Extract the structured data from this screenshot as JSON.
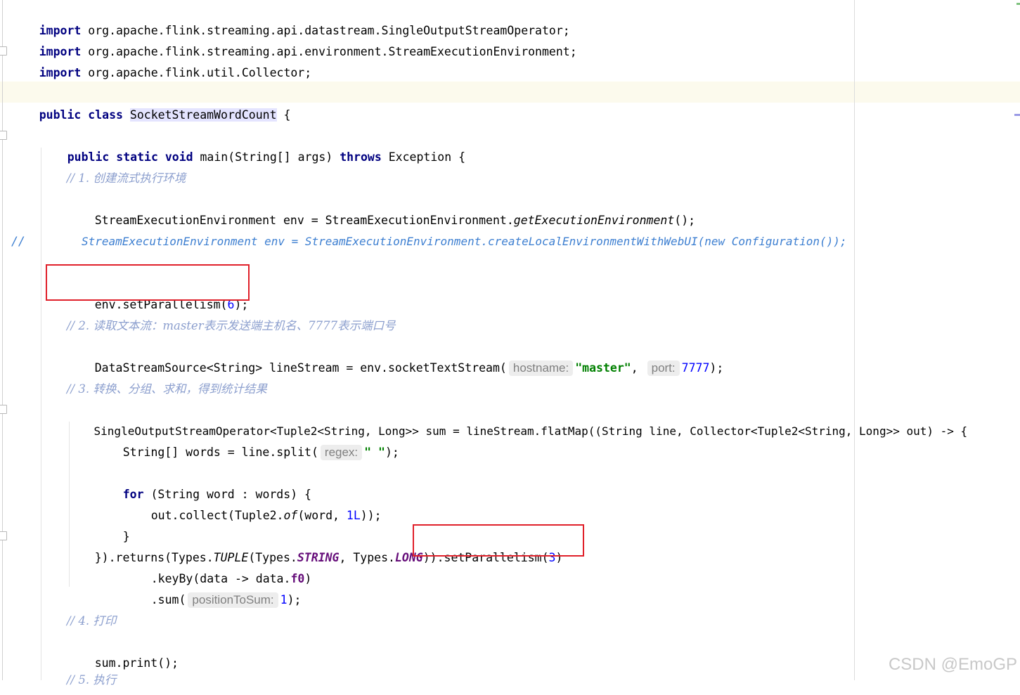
{
  "code": {
    "l1_kw": "import",
    "l1_text": " org.apache.flink.streaming.api.datastream.SingleOutputStreamOperator;",
    "l2_kw": "import",
    "l2_text": " org.apache.flink.streaming.api.environment.StreamExecutionEnvironment;",
    "l3_kw": "import",
    "l3_text": " org.apache.flink.util.Collector;",
    "l4_kw": "public class ",
    "l4_class": "SocketStreamWordCount",
    "l4_rest": " {",
    "l5_kw1": "public static void ",
    "l5_mid": "main(String[] args) ",
    "l5_kw2": "throws",
    "l5_rest": " Exception {",
    "l6_comment": "// 1. 创建流式执行环境",
    "l7_a": "StreamExecutionEnvironment env = StreamExecutionEnvironment.",
    "l7_m": "getExecutionEnvironment",
    "l7_b": "();",
    "l8_slash": "//",
    "l8_text": "StreamExecutionEnvironment env = StreamExecutionEnvironment.createLocalEnvironmentWithWebUI(new Configuration());",
    "l9_a": "env.setParallelism(",
    "l9_num": "6",
    "l9_b": ");",
    "l10_comment": "// 2. 读取文本流：master表示发送端主机名、7777表示端口号",
    "l11_a": "DataStreamSource<String> lineStream = env.socketTextStream(",
    "l11_hint1": "hostname:",
    "l11_str": "\"master\"",
    "l11_comma": ", ",
    "l11_hint2": "port:",
    "l11_num": "7777",
    "l11_b": ");",
    "l12_comment": "// 3. 转换、分组、求和，得到统计结果",
    "l13_text": "SingleOutputStreamOperator<Tuple2<String, Long>> sum = lineStream.flatMap((String line, Collector<Tuple2<String, Long>> out) -> {",
    "l14_a": "String[] words = line.split(",
    "l14_hint": "regex:",
    "l14_str": "\" \"",
    "l14_b": ");",
    "l15_kw": "for",
    "l15_rest": " (String word : words) {",
    "l16_a": "out.collect(Tuple2.",
    "l16_m": "of",
    "l16_b": "(word, ",
    "l16_num": "1L",
    "l16_c": "));",
    "l17_text": "}",
    "l18_a": "}).returns(Types.",
    "l18_f1": "TUPLE",
    "l18_b": "(Types.",
    "l18_f2": "STRING",
    "l18_c": ", Types.",
    "l18_f3": "LONG",
    "l18_d": ")).setParallelism(",
    "l18_num": "3",
    "l18_e": ")",
    "l19_a": ".keyBy(data -> data.",
    "l19_field": "f0",
    "l19_b": ")",
    "l20_a": ".sum(",
    "l20_hint": "positionToSum:",
    "l20_num": "1",
    "l20_b": ");",
    "l21_comment": "// 4. 打印",
    "l22_text": "sum.print();",
    "l23_comment": "// 5. 执行"
  },
  "watermark": "CSDN @EmoGP",
  "colors": {
    "keyword": "#000080",
    "comment": "#8c9fce",
    "number": "#0000ff",
    "string": "#008000",
    "highlight_box": "#e0202a"
  }
}
